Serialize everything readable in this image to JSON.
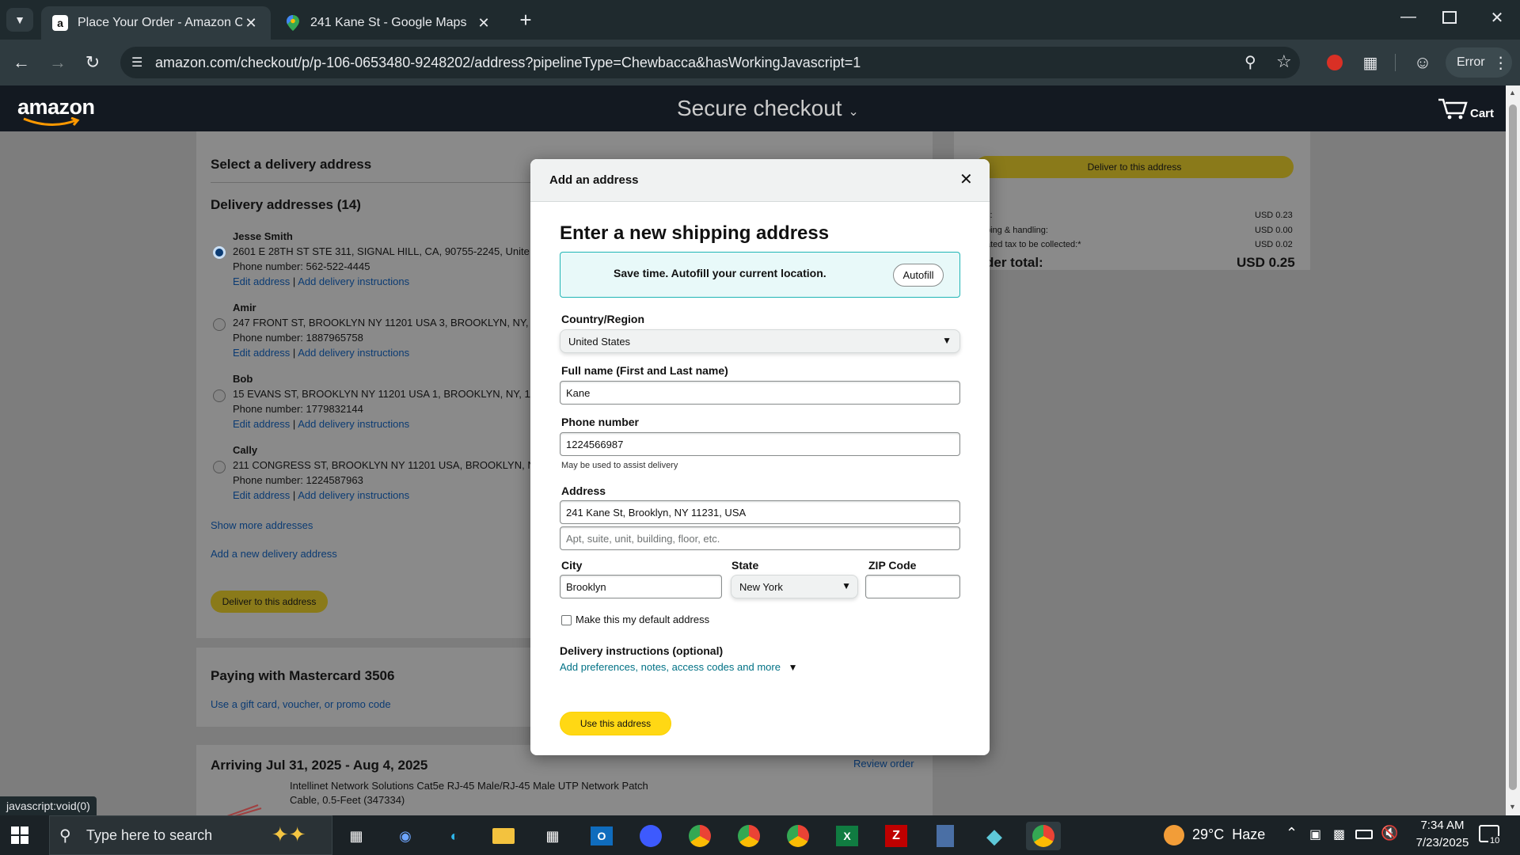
{
  "browser": {
    "tabs": [
      {
        "title": "Place Your Order - Amazon Che",
        "favicon": "a"
      },
      {
        "title": "241 Kane St - Google Maps",
        "favicon": "map-pin"
      }
    ],
    "url": "amazon.com/checkout/p/p-106-0653480-9248202/address?pipelineType=Chewbacca&hasWorkingJavascript=1",
    "profile_label": "Error",
    "status_bar": "javascript:void(0)"
  },
  "amazon_header": {
    "logo": "amazon",
    "title": "Secure checkout",
    "cart_label": "Cart"
  },
  "background": {
    "section_title": "Select a delivery address",
    "addresses_heading": "Delivery addresses (14)",
    "addresses": [
      {
        "name": "Jesse Smith",
        "line": "2601 E 28TH ST STE 311, SIGNAL HILL, CA, 90755-2245, Unite",
        "phone": "Phone number: 562-522-4445",
        "selected": true
      },
      {
        "name": "Amir",
        "line": "247 FRONT ST, BROOKLYN NY 11201 USA 3, BROOKLYN, NY, 1",
        "phone": "Phone number: 1887965758",
        "selected": false
      },
      {
        "name": "Bob",
        "line": "15 EVANS ST, BROOKLYN NY 11201 USA 1, BROOKLYN, NY, 11",
        "phone": "Phone number: 1779832144",
        "selected": false
      },
      {
        "name": "Cally",
        "line": "211 CONGRESS ST, BROOKLYN NY 11201 USA, BROOKLYN, NY,",
        "phone": "Phone number: 1224587963",
        "selected": false
      }
    ],
    "edit_link": "Edit address",
    "instructions_link": "Add delivery instructions",
    "separator": "|",
    "show_more": "Show more addresses",
    "add_new": "Add a new delivery address",
    "deliver_button": "Deliver to this address",
    "paying_heading": "Paying with Mastercard 3506",
    "gift_link": "Use a gift card, voucher, or promo code",
    "arriving_heading": "Arriving Jul 31, 2025 - Aug 4, 2025",
    "review_order": "Review order",
    "product_title_1": "Intellinet Network Solutions Cat5e RJ-45 Male/RJ-45 Male UTP Network Patch",
    "product_title_2": "Cable, 0.5-Feet (347334)",
    "summary": {
      "deliver_button": "Deliver to this address",
      "rows": [
        {
          "label": "s:",
          "value": "USD 0.23"
        },
        {
          "label": "ping & handling:",
          "value": "USD 0.00"
        },
        {
          "label": "ated tax to be collected:*",
          "value": "USD 0.02"
        }
      ],
      "total_label": "der total:",
      "total_value": "USD 0.25"
    }
  },
  "modal": {
    "header": "Add an address",
    "heading": "Enter a new shipping address",
    "autofill_text": "Save time. Autofill your current location.",
    "autofill_button": "Autofill",
    "country_label": "Country/Region",
    "country_value": "United States",
    "name_label": "Full name (First and Last name)",
    "name_value": "Kane",
    "phone_label": "Phone number",
    "phone_value": "1224566987",
    "phone_hint": "May be used to assist delivery",
    "address_label": "Address",
    "address_value": "241 Kane St, Brooklyn, NY 11231, USA",
    "address2_placeholder": "Apt, suite, unit, building, floor, etc.",
    "city_label": "City",
    "city_value": "Brooklyn",
    "state_label": "State",
    "state_value": "New York",
    "zip_label": "ZIP Code",
    "zip_value": "",
    "default_checkbox": "Make this my default address",
    "instructions_heading": "Delivery instructions (optional)",
    "instructions_link": "Add preferences, notes, access codes and more",
    "submit_button": "Use this address"
  },
  "taskbar": {
    "search_placeholder": "Type here to search",
    "weather": "29°C  Haze",
    "time": "7:34 AM",
    "date": "7/23/2025",
    "notification_count": "10"
  },
  "colors": {
    "amazon_yellow": "#ffd814",
    "autofill_bg": "#e8f9f9",
    "autofill_border": "#1fb5b5",
    "link_blue": "#007185"
  }
}
